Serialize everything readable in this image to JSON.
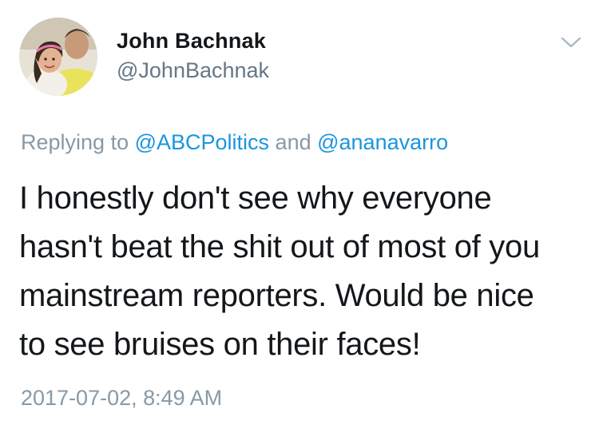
{
  "author": {
    "display_name": "John Bachnak",
    "handle": "@JohnBachnak"
  },
  "reply": {
    "prefix": "Replying to ",
    "mention_1": "@ABCPolitics",
    "conjunction": " and ",
    "mention_2": "@ananavarro"
  },
  "tweet": {
    "lines": [
      "I honestly don't see why everyone",
      "hasn't beat the shit out of most of you",
      "mainstream reporters. Would be nice",
      "to see bruises on their faces!"
    ]
  },
  "timestamp": "2017-07-02, 8:49 AM",
  "icons": {
    "menu": "chevron-down-icon"
  },
  "colors": {
    "text": "#14171a",
    "secondary": "#657786",
    "muted": "#8899a6",
    "link": "#1b95e0"
  }
}
